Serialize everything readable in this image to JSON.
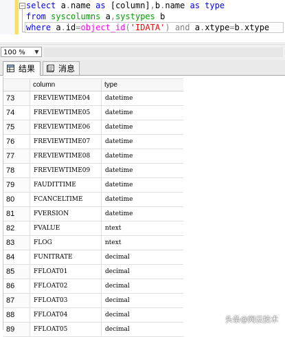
{
  "editor": {
    "lines": [
      [
        {
          "t": "select ",
          "c": "kw"
        },
        {
          "t": "a",
          "c": ""
        },
        {
          "t": ".",
          "c": "op"
        },
        {
          "t": "name ",
          "c": ""
        },
        {
          "t": "as ",
          "c": "kw"
        },
        {
          "t": "[column]",
          "c": ""
        },
        {
          "t": ",",
          "c": "op"
        },
        {
          "t": "b",
          "c": ""
        },
        {
          "t": ".",
          "c": "op"
        },
        {
          "t": "name ",
          "c": ""
        },
        {
          "t": "as ",
          "c": "kw"
        },
        {
          "t": "type",
          "c": "kw"
        }
      ],
      [
        {
          "t": "from ",
          "c": "kw"
        },
        {
          "t": "syscolumns ",
          "c": "sys"
        },
        {
          "t": "a",
          "c": ""
        },
        {
          "t": ",",
          "c": "op"
        },
        {
          "t": "systypes ",
          "c": "sys"
        },
        {
          "t": "b",
          "c": ""
        }
      ],
      [
        {
          "t": "where ",
          "c": "kw"
        },
        {
          "t": "a",
          "c": ""
        },
        {
          "t": ".",
          "c": "op"
        },
        {
          "t": "id",
          "c": ""
        },
        {
          "t": "=",
          "c": "op"
        },
        {
          "t": "object_id",
          "c": "fn"
        },
        {
          "t": "(",
          "c": "op"
        },
        {
          "t": "'IDATA'",
          "c": "str"
        },
        {
          "t": ") ",
          "c": "op"
        },
        {
          "t": "and ",
          "c": "op"
        },
        {
          "t": "a",
          "c": ""
        },
        {
          "t": ".",
          "c": "op"
        },
        {
          "t": "xtype",
          "c": ""
        },
        {
          "t": "=",
          "c": "op"
        },
        {
          "t": "b",
          "c": ""
        },
        {
          "t": ".",
          "c": "op"
        },
        {
          "t": "xtype",
          "c": ""
        }
      ]
    ]
  },
  "toolbar": {
    "zoom_value": "100 %",
    "zoom_arrow": "▼"
  },
  "tabs": {
    "results_label": "结果",
    "messages_label": "消息"
  },
  "grid": {
    "columns": [
      "column",
      "type"
    ],
    "rows": [
      {
        "n": "73",
        "column": "FREVIEWTIME04",
        "type": "datetime"
      },
      {
        "n": "74",
        "column": "FREVIEWTIME05",
        "type": "datetime"
      },
      {
        "n": "75",
        "column": "FREVIEWTIME06",
        "type": "datetime"
      },
      {
        "n": "76",
        "column": "FREVIEWTIME07",
        "type": "datetime"
      },
      {
        "n": "77",
        "column": "FREVIEWTIME08",
        "type": "datetime"
      },
      {
        "n": "78",
        "column": "FREVIEWTIME09",
        "type": "datetime"
      },
      {
        "n": "79",
        "column": "FAUDITTIME",
        "type": "datetime"
      },
      {
        "n": "80",
        "column": "FCANCELTIME",
        "type": "datetime"
      },
      {
        "n": "81",
        "column": "FVERSION",
        "type": "datetime"
      },
      {
        "n": "82",
        "column": "FVALUE",
        "type": "ntext"
      },
      {
        "n": "83",
        "column": "FLOG",
        "type": "ntext"
      },
      {
        "n": "84",
        "column": "FUNITRATE",
        "type": "decimal"
      },
      {
        "n": "85",
        "column": "FFLOAT01",
        "type": "decimal"
      },
      {
        "n": "86",
        "column": "FFLOAT02",
        "type": "decimal"
      },
      {
        "n": "87",
        "column": "FFLOAT03",
        "type": "decimal"
      },
      {
        "n": "88",
        "column": "FFLOAT04",
        "type": "decimal"
      },
      {
        "n": "89",
        "column": "FFLOAT05",
        "type": "decimal"
      }
    ]
  },
  "watermark": "头条@网云技术"
}
